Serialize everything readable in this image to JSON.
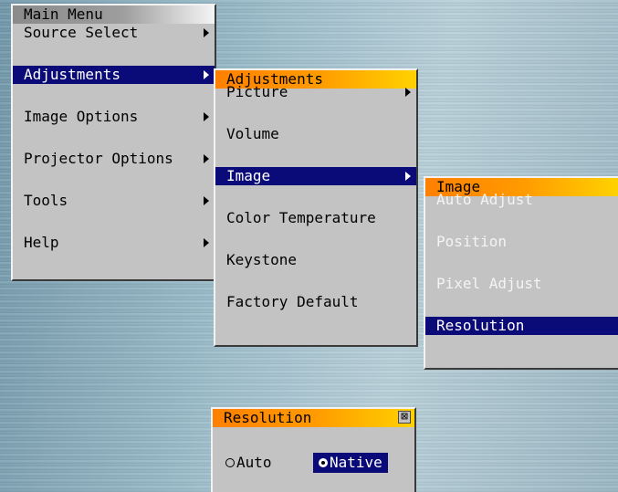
{
  "main_menu": {
    "title": "Main Menu",
    "items": [
      {
        "label": "Source Select",
        "arrow": true
      },
      {
        "label": "Adjustments",
        "arrow": true,
        "selected": true
      },
      {
        "label": "Image Options",
        "arrow": true
      },
      {
        "label": "Projector Options",
        "arrow": true
      },
      {
        "label": "Tools",
        "arrow": true
      },
      {
        "label": "Help",
        "arrow": true
      }
    ]
  },
  "adjustments_menu": {
    "title": "Adjustments",
    "items": [
      {
        "label": "Picture",
        "arrow": true
      },
      {
        "label": "Volume"
      },
      {
        "label": "Image",
        "arrow": true,
        "selected": true
      },
      {
        "label": "Color Temperature"
      },
      {
        "label": "Keystone"
      },
      {
        "label": "Factory Default"
      }
    ]
  },
  "image_menu": {
    "title": "Image",
    "items": [
      {
        "label": "Auto Adjust",
        "disabled": true
      },
      {
        "label": "Position",
        "disabled": true
      },
      {
        "label": "Pixel Adjust",
        "disabled": true
      },
      {
        "label": "Resolution",
        "selected": true
      }
    ]
  },
  "resolution_dialog": {
    "title": "Resolution",
    "close_glyph": "⊠",
    "options": [
      {
        "label": "Auto",
        "selected": false
      },
      {
        "label": "Native",
        "selected": true
      }
    ]
  },
  "colors": {
    "panel": "#c3c3c3",
    "selection": "#0a0a78",
    "accent_orange": "#ff8000",
    "disabled_text": "#f4f4f4"
  }
}
